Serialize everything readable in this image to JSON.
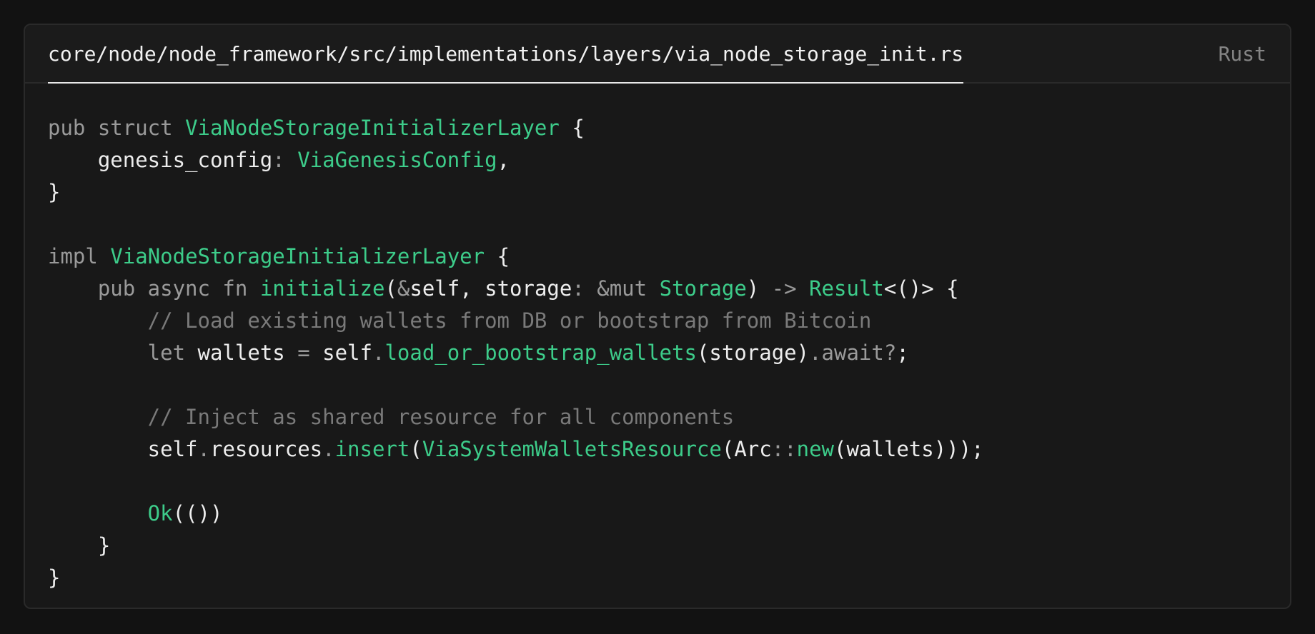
{
  "file": {
    "path": "core/node/node_framework/src/implementations/layers/via_node_storage_init.rs",
    "language": "Rust"
  },
  "colors": {
    "background": "#121212",
    "card": "#181818",
    "keyword": "#9a9a9a",
    "type_function": "#3dcc8a",
    "comment": "#7a7a7a",
    "text": "#ededed"
  },
  "code_lines": [
    [
      {
        "t": "kw",
        "v": "pub struct "
      },
      {
        "t": "type",
        "v": "ViaNodeStorageInitializerLayer"
      },
      {
        "t": "text",
        "v": " {"
      }
    ],
    [
      {
        "t": "text",
        "v": "    genesis_config"
      },
      {
        "t": "punct",
        "v": ": "
      },
      {
        "t": "type",
        "v": "ViaGenesisConfig"
      },
      {
        "t": "text",
        "v": ","
      }
    ],
    [
      {
        "t": "text",
        "v": "}"
      }
    ],
    [],
    [
      {
        "t": "kw",
        "v": "impl "
      },
      {
        "t": "type",
        "v": "ViaNodeStorageInitializerLayer"
      },
      {
        "t": "text",
        "v": " {"
      }
    ],
    [
      {
        "t": "kw",
        "v": "    pub async fn "
      },
      {
        "t": "fn",
        "v": "initialize"
      },
      {
        "t": "text",
        "v": "("
      },
      {
        "t": "punct",
        "v": "&"
      },
      {
        "t": "text",
        "v": "self, storage"
      },
      {
        "t": "punct",
        "v": ": &mut "
      },
      {
        "t": "type",
        "v": "Storage"
      },
      {
        "t": "text",
        "v": ")"
      },
      {
        "t": "punct",
        "v": " -> "
      },
      {
        "t": "type",
        "v": "Result"
      },
      {
        "t": "text",
        "v": "<()> {"
      }
    ],
    [
      {
        "t": "comment",
        "v": "        // Load existing wallets from DB or bootstrap from Bitcoin"
      }
    ],
    [
      {
        "t": "kw",
        "v": "        let "
      },
      {
        "t": "text",
        "v": "wallets "
      },
      {
        "t": "punct",
        "v": "="
      },
      {
        "t": "text",
        "v": " self"
      },
      {
        "t": "punct",
        "v": "."
      },
      {
        "t": "fn",
        "v": "load_or_bootstrap_wallets"
      },
      {
        "t": "text",
        "v": "(storage)"
      },
      {
        "t": "punct",
        "v": ".await?"
      },
      {
        "t": "text",
        "v": ";"
      }
    ],
    [],
    [
      {
        "t": "comment",
        "v": "        // Inject as shared resource for all components"
      }
    ],
    [
      {
        "t": "text",
        "v": "        self"
      },
      {
        "t": "punct",
        "v": "."
      },
      {
        "t": "text",
        "v": "resources"
      },
      {
        "t": "punct",
        "v": "."
      },
      {
        "t": "fn",
        "v": "insert"
      },
      {
        "t": "text",
        "v": "("
      },
      {
        "t": "type",
        "v": "ViaSystemWalletsResource"
      },
      {
        "t": "text",
        "v": "(Arc"
      },
      {
        "t": "punct",
        "v": "::"
      },
      {
        "t": "fn",
        "v": "new"
      },
      {
        "t": "text",
        "v": "(wallets)));"
      }
    ],
    [],
    [
      {
        "t": "type",
        "v": "        Ok"
      },
      {
        "t": "text",
        "v": "(())"
      }
    ],
    [
      {
        "t": "text",
        "v": "    }"
      }
    ],
    [
      {
        "t": "text",
        "v": "}"
      }
    ]
  ]
}
